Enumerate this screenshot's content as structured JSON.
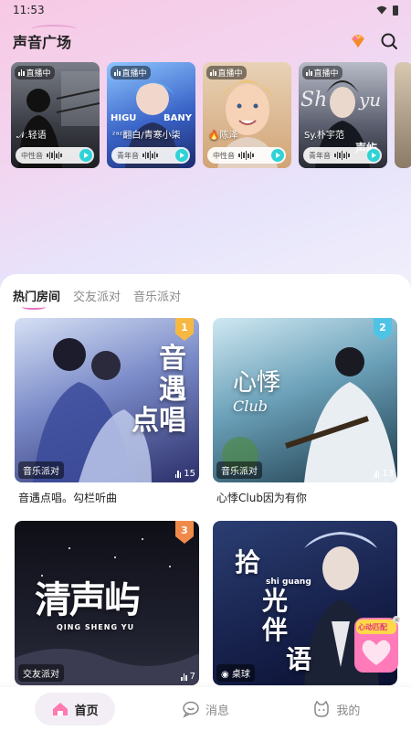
{
  "status_bar": {
    "time": "11:53"
  },
  "header": {
    "title": "声音广场"
  },
  "live_cards": [
    {
      "badge": "直播中",
      "name": "𝒩.轻语",
      "voice": "中性音",
      "bg": "#3a3c44"
    },
    {
      "badge": "直播中",
      "name": "ᶻᵃᶻ翻白/青寒小柒",
      "overlay": "HIGU BANY",
      "voice": "青年音",
      "bg": "#2a4ea8"
    },
    {
      "badge": "直播中",
      "name": "🔥陈泽",
      "voice": "中性音",
      "bg": "#d9b48a"
    },
    {
      "badge": "直播中",
      "name": "Sy.朴宇范",
      "overlay": "Sh  yu",
      "voice": "青年音",
      "bg": "#5a5e6e"
    },
    {
      "badge": "",
      "name": "",
      "voice": "",
      "bg": "#c8b6a0"
    }
  ],
  "tabs": [
    "热门房间",
    "交友派对",
    "音乐派对"
  ],
  "rooms": [
    {
      "title_overlay": [
        "音",
        "遇",
        "点",
        "唱"
      ],
      "tag": "音乐派对",
      "count": "15",
      "rank": "1",
      "caption": "音遇点唱。勾栏听曲"
    },
    {
      "title_overlay": [
        "心",
        "悸"
      ],
      "title_overlay_en": "Club",
      "tag": "音乐派对",
      "count": "13",
      "rank": "2",
      "caption": "心悸Club因为有你"
    },
    {
      "title_overlay": [
        "清",
        "声",
        "屿"
      ],
      "title_overlay_en": "QING SHENG YU",
      "tag": "交友派对",
      "count": "7",
      "rank": "3",
      "caption": ""
    },
    {
      "title_overlay": [
        "拾",
        "光",
        "伴",
        "语"
      ],
      "title_overlay_en": "shi guang",
      "tag": "桌球",
      "count": "",
      "rank": "",
      "caption": ""
    }
  ],
  "match_badge": {
    "label": "心动匹配"
  },
  "nav": [
    {
      "label": "首页",
      "active": true
    },
    {
      "label": "消息",
      "active": false
    },
    {
      "label": "我的",
      "active": false
    }
  ],
  "colors": {
    "accent_pink": "#e86fc0",
    "play_cyan": "#2fd3d6"
  }
}
